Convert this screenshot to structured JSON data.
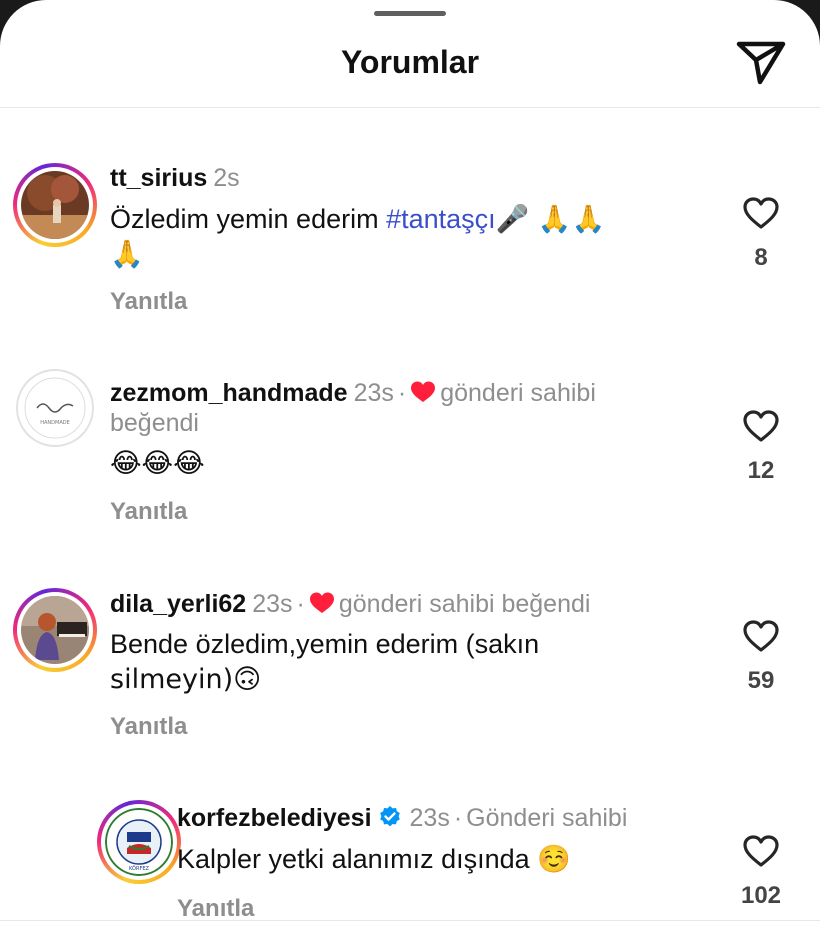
{
  "header": {
    "title": "Yorumlar",
    "share_icon": "paper-plane-icon"
  },
  "comments": [
    {
      "username": "tt_sirius",
      "time": "2s",
      "text_before": "Özledim yemin ederim ",
      "hashtag": "#tantaşçı",
      "text_after": "🎤  🙏🙏",
      "text_line2": "🙏",
      "reply": "Yanıtla",
      "likes": "8"
    },
    {
      "username": "zezmom_handmade",
      "time": "23s",
      "liked_by_author": "gönderi sahibi",
      "liked_by_author_2": "beğendi",
      "text": "😂😂😂",
      "reply": "Yanıtla",
      "likes": "12"
    },
    {
      "username": "dila_yerli62",
      "time": "23s",
      "liked_by_author": "gönderi sahibi beğendi",
      "text": "Bende özledim,yemin ederim (sakın",
      "text_line2": "silmeyin)🙃",
      "reply": "Yanıtla",
      "likes": "59"
    },
    {
      "username": "korfezbelediyesi",
      "time": "23s",
      "role": "Gönderi sahibi",
      "text": "Kalpler yetki alanımız dışında ☺️",
      "reply": "Yanıtla",
      "likes": "102"
    }
  ],
  "colors": {
    "hashtag": "#3a4fc9",
    "heart_red": "#ff1f3d",
    "verified_blue": "#0095f6",
    "muted_text": "#8e8e8e"
  }
}
